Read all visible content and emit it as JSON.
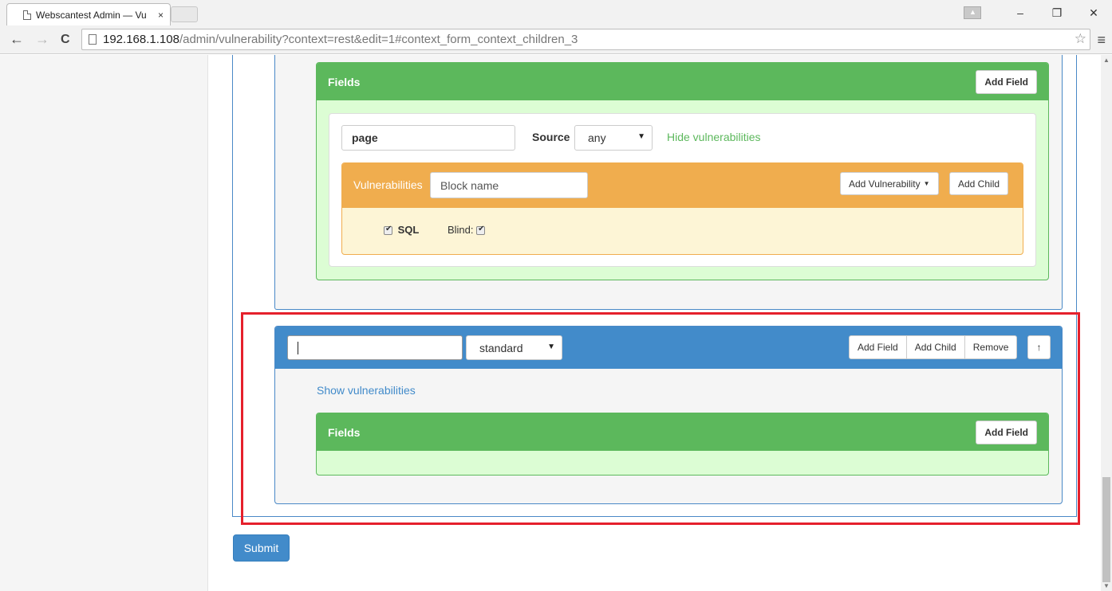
{
  "browser": {
    "tab_title": "Webscantest Admin — Vu",
    "tab_close": "×",
    "url_host": "192.168.1.108",
    "url_path": "/admin/vulnerability?context=rest&edit=1#context_form_context_children_3",
    "back_icon": "←",
    "forward_icon": "→",
    "reload_icon": "C",
    "star_icon": "☆",
    "menu_icon": "≡",
    "minimize_icon": "–",
    "restore_icon": "❐",
    "close_icon": "✕"
  },
  "context_top": {
    "fields_header": "Fields",
    "add_field_label": "Add Field",
    "field": {
      "name_value": "page",
      "source_label": "Source",
      "source_value": "any",
      "hide_vuln_link": "Hide vulnerabilities"
    },
    "vulnerabilities": {
      "header_label": "Vulnerabilities",
      "block_name_placeholder": "Block name",
      "add_vuln_label": "Add Vulnerability",
      "add_child_label": "Add Child",
      "sql_label": "SQL",
      "blind_label": "Blind:"
    }
  },
  "context_bottom": {
    "name_value": "",
    "type_value": "standard",
    "buttons": {
      "add_field": "Add Field",
      "add_child": "Add Child",
      "remove": "Remove",
      "move_up": "↑"
    },
    "show_vuln_link": "Show vulnerabilities",
    "fields_header": "Fields",
    "add_field_label": "Add Field"
  },
  "submit_label": "Submit"
}
